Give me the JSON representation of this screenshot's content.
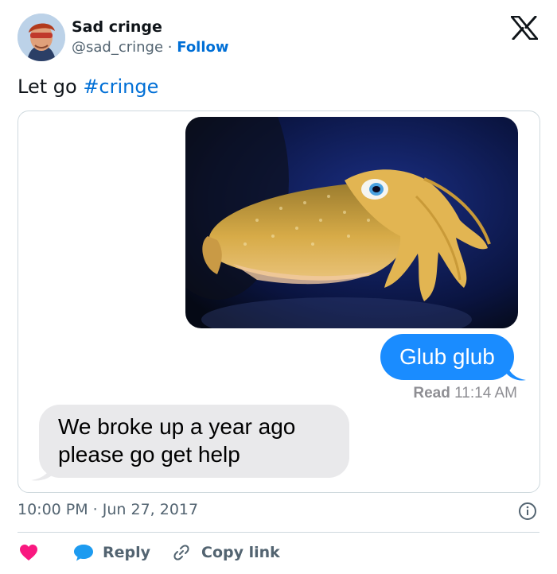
{
  "author": {
    "name": "Sad cringe",
    "handle": "@sad_cringe",
    "separator": "·",
    "follow_label": "Follow"
  },
  "tweet": {
    "text": "Let go ",
    "hashtag": "#cringe"
  },
  "conversation": {
    "sent_message": "Glub glub",
    "read_label": "Read",
    "read_time": "11:14 AM",
    "received_line1": "We broke up a year ago",
    "received_line2": "please go get help"
  },
  "meta": {
    "timestamp": "10:00 PM · Jun 27, 2017"
  },
  "actions": {
    "reply_label": "Reply",
    "copy_link_label": "Copy link"
  },
  "icons": {
    "platform_logo": "x-logo-icon",
    "info": "info-icon",
    "like": "heart-icon",
    "reply": "speech-bubble-icon",
    "copy_link": "link-icon"
  },
  "colors": {
    "link_blue": "#006fd6",
    "imessage_blue": "#1a8cff",
    "received_gray": "#e9e9eb",
    "heart_pink": "#f91880"
  }
}
